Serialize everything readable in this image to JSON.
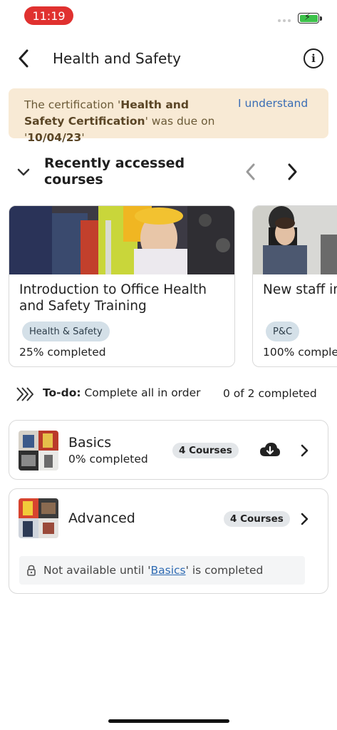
{
  "status_bar": {
    "time": "11:19",
    "accent_color": "#e0312f",
    "battery_color": "#3cc24a"
  },
  "header": {
    "title": "Health and Safety",
    "back_icon": "chevron-left-icon",
    "info_icon": "info-icon"
  },
  "alert": {
    "prefix": "The certification '",
    "cert_name": "Health and Safety Certification",
    "middle": "' was due on '",
    "due_date": "10/04/23",
    "suffix": "'",
    "action_label": "I understand",
    "background": "#f8ead5"
  },
  "recent": {
    "title": "Recently accessed courses",
    "courses": [
      {
        "title": "Introduction to Office Health and Safety Training",
        "tag": "Health & Safety",
        "progress_label": "25% completed",
        "progress": 0.25
      },
      {
        "title": "New staff in",
        "tag": "P&C",
        "progress_label": "100% complet",
        "progress": 1.0
      }
    ]
  },
  "todo": {
    "label_bold": "To-do:",
    "label_rest": " Complete all in order",
    "count": "0 of 2 completed"
  },
  "modules": [
    {
      "name": "Basics",
      "progress_label": "0% completed",
      "course_count": "4 Courses"
    },
    {
      "name": "Advanced",
      "course_count": "4 Courses",
      "lock_prefix": "Not available until '",
      "lock_link": "Basics",
      "lock_suffix": "' is completed"
    }
  ],
  "colors": {
    "tag_bg": "#d4e0e8",
    "link": "#2f6bb3"
  }
}
